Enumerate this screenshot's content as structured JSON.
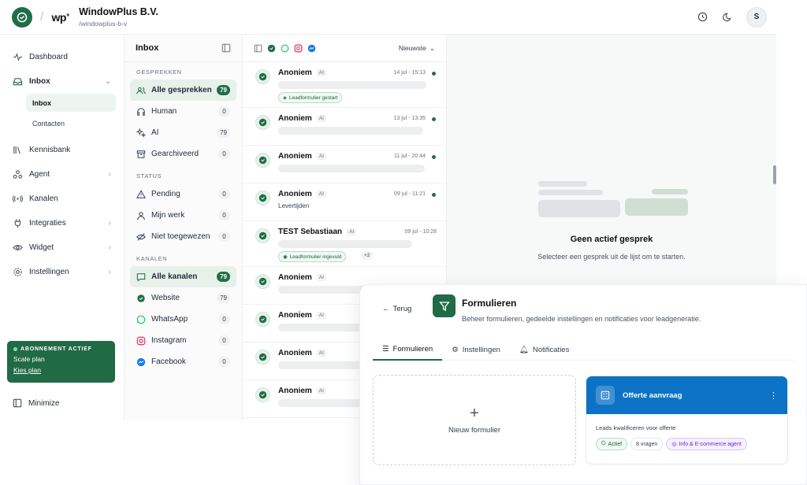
{
  "header": {
    "brand": "wp",
    "org_name": "WindowPlus B.V.",
    "org_slug": "/windowplus-b-v",
    "avatar_initial": "S",
    "separator": "/"
  },
  "sidebar": {
    "items": [
      {
        "label": "Dashboard",
        "icon": "activity-icon"
      },
      {
        "label": "Inbox",
        "icon": "inbox-icon"
      },
      {
        "label": "Kennisbank",
        "icon": "library-icon"
      },
      {
        "label": "Agent",
        "icon": "agent-icon"
      },
      {
        "label": "Kanalen",
        "icon": "radio-icon"
      },
      {
        "label": "Integraties",
        "icon": "plug-icon"
      },
      {
        "label": "Widget",
        "icon": "eye-icon"
      },
      {
        "label": "Instellingen",
        "icon": "gear-icon"
      }
    ],
    "sub_items": {
      "inbox": "Inbox",
      "contacten": "Contacten"
    },
    "plan": {
      "badge": "ABONNEMENT ACTIEF",
      "name": "Scale plan",
      "link": "Kies plan"
    },
    "minimize": "Minimize"
  },
  "inbox": {
    "title": "Inbox",
    "sections": {
      "gesprekken": "GESPREKKEN",
      "status": "STATUS",
      "kanalen": "KANALEN"
    },
    "gesprekken": [
      {
        "label": "Alle gesprekken",
        "count": "79"
      },
      {
        "label": "Human",
        "count": "0"
      },
      {
        "label": "AI",
        "count": "79"
      },
      {
        "label": "Gearchiveerd",
        "count": "0"
      }
    ],
    "status": [
      {
        "label": "Pending",
        "count": "0"
      },
      {
        "label": "Mijn werk",
        "count": "0"
      },
      {
        "label": "Niet toegewezen",
        "count": "0"
      }
    ],
    "kanalen": [
      {
        "label": "Alle kanalen",
        "count": "79"
      },
      {
        "label": "Website",
        "count": "79"
      },
      {
        "label": "WhatsApp",
        "count": "0"
      },
      {
        "label": "Instagram",
        "count": "0"
      },
      {
        "label": "Facebook",
        "count": "0"
      }
    ]
  },
  "conversations": {
    "sort": "Nieuwste",
    "items": [
      {
        "name": "Anoniem",
        "tag": "AI",
        "time": "14 jul - 15:13",
        "badge": "Leadformulier gestart",
        "text": ""
      },
      {
        "name": "Anoniem",
        "tag": "AI",
        "time": "13 jul - 13:35",
        "badge": "",
        "text": ""
      },
      {
        "name": "Anoniem",
        "tag": "AI",
        "time": "11 jul - 20:44",
        "badge": "",
        "text": ""
      },
      {
        "name": "Anoniem",
        "tag": "AI",
        "time": "09 jul - 11:21",
        "badge": "",
        "text": "Levertijden"
      },
      {
        "name": "TEST Sebastiaan",
        "tag": "AI",
        "time": "09 jul - 10:28",
        "badge": "Leadformulier ingevuld",
        "extra": "+2",
        "text": ""
      },
      {
        "name": "Anoniem",
        "tag": "AI",
        "time": "",
        "badge": "",
        "text": ""
      },
      {
        "name": "Anoniem",
        "tag": "AI",
        "time": "",
        "badge": "",
        "text": ""
      },
      {
        "name": "Anoniem",
        "tag": "AI",
        "time": "",
        "badge": "",
        "text": ""
      },
      {
        "name": "Anoniem",
        "tag": "AI",
        "time": "",
        "badge": "",
        "text": ""
      }
    ]
  },
  "empty_state": {
    "title": "Geen actief gesprek",
    "subtitle": "Selecteer een gesprek uit de lijst om te starten."
  },
  "forms_panel": {
    "back": "Terug",
    "title": "Formulieren",
    "subtitle": "Beheer formulieren, gedeelde instellingen en notificaties voor leadgeneratie.",
    "tabs": [
      "Formulieren",
      "Instellingen",
      "Notificaties"
    ],
    "new_form": "Nieuw formulier",
    "card": {
      "title": "Offerte aanvraag",
      "description": "Leads kwalificeren voor offerte",
      "status": "Actief",
      "questions": "8 vragen",
      "agent": "Info & E-commerce agent",
      "menu": "⋮"
    }
  },
  "colors": {
    "brand_green": "#216a46",
    "card_blue": "#0b72c6",
    "active_bg": "#e7f1ea"
  }
}
